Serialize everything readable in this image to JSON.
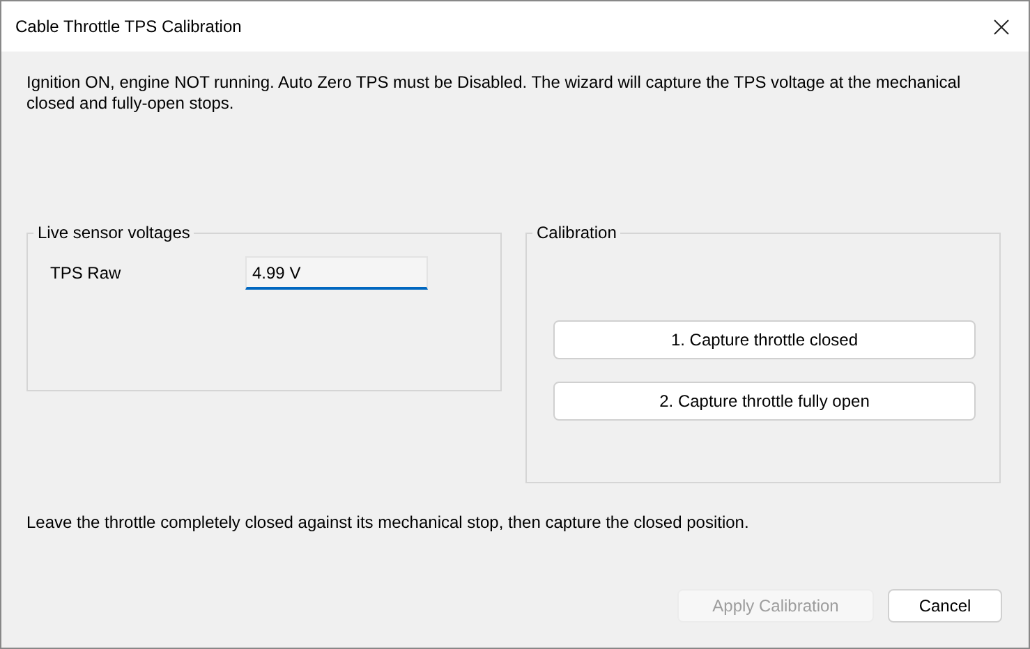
{
  "window": {
    "title": "Cable Throttle TPS Calibration"
  },
  "instructions": "Ignition ON, engine NOT running. Auto Zero TPS must be Disabled. The wizard will capture the TPS voltage at the mechanical closed and fully-open stops.",
  "live_group": {
    "title": "Live sensor voltages",
    "fields": [
      {
        "label": "TPS Raw",
        "value": "4.99 V",
        "focused": true
      }
    ]
  },
  "calibration_group": {
    "title": "Calibration",
    "buttons": [
      {
        "label": "1. Capture throttle closed",
        "disabled": false
      },
      {
        "label": "2. Capture throttle fully open",
        "disabled": false
      }
    ]
  },
  "hint": "Leave the throttle completely closed against its mechanical stop, then capture the closed position.",
  "footer_buttons": [
    {
      "label": "Apply Calibration",
      "disabled": true
    },
    {
      "label": "Cancel",
      "disabled": false
    }
  ]
}
